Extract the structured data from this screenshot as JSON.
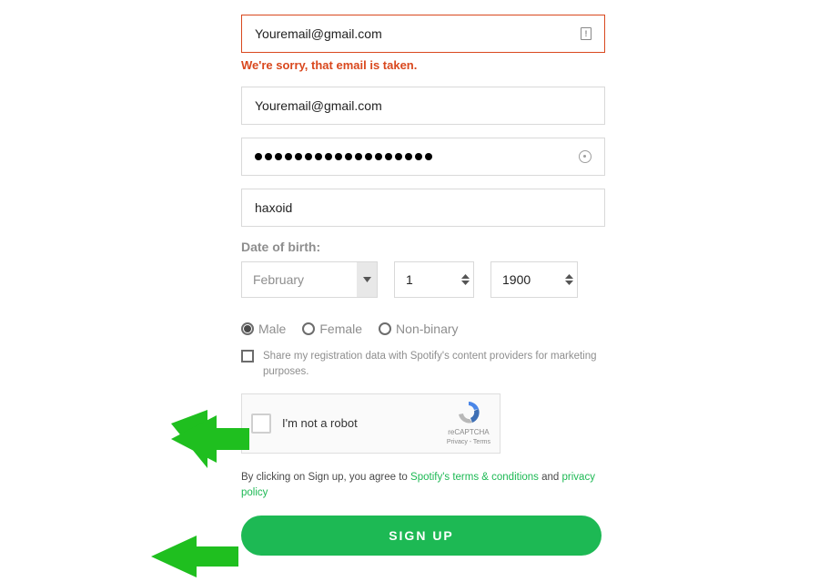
{
  "form": {
    "email": {
      "value": "Youremail@gmail.com",
      "error": "We're sorry, that email is taken."
    },
    "confirm_email": {
      "value": "Youremail@gmail.com"
    },
    "password": {
      "dot_count": 18
    },
    "display_name": {
      "value": "haxoid"
    },
    "dob": {
      "label": "Date of birth:",
      "month": "February",
      "day": "1",
      "year": "1900"
    },
    "gender": {
      "options": [
        {
          "label": "Male",
          "checked": true
        },
        {
          "label": "Female",
          "checked": false
        },
        {
          "label": "Non-binary",
          "checked": false
        }
      ]
    },
    "share": {
      "label": "Share my registration data with Spotify's content providers for marketing purposes."
    },
    "captcha": {
      "label": "I'm not a robot",
      "brand": "reCAPTCHA",
      "links": "Privacy  - Terms"
    },
    "terms": {
      "prefix": "By clicking on Sign up, you agree to ",
      "link1": "Spotify's terms & conditions",
      "mid": " and ",
      "link2": "privacy policy"
    },
    "signup_label": "SIGN UP"
  }
}
